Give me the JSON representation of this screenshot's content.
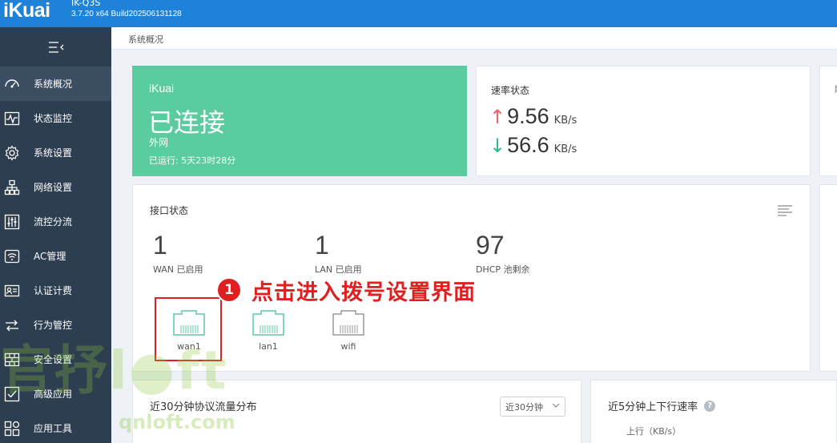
{
  "header": {
    "logo_text": "iKuai",
    "model": "IK-Q3S",
    "build": "3.7.20 x64 Build202506131128"
  },
  "sidebar": {
    "items": [
      {
        "label": "系统概况",
        "icon": "dashboard-icon",
        "active": true
      },
      {
        "label": "状态监控",
        "icon": "monitor-icon",
        "active": false
      },
      {
        "label": "系统设置",
        "icon": "gear-icon",
        "active": false
      },
      {
        "label": "网络设置",
        "icon": "network-icon",
        "active": false
      },
      {
        "label": "流控分流",
        "icon": "sliders-icon",
        "active": false
      },
      {
        "label": "AC管理",
        "icon": "wifi-icon",
        "active": false
      },
      {
        "label": "认证计费",
        "icon": "id-card-icon",
        "active": false
      },
      {
        "label": "行为管控",
        "icon": "arrows-icon",
        "active": false
      },
      {
        "label": "安全设置",
        "icon": "firewall-icon",
        "active": false
      },
      {
        "label": "高级应用",
        "icon": "checklist-icon",
        "active": false
      },
      {
        "label": "应用工具",
        "icon": "apps-icon",
        "active": false
      }
    ]
  },
  "breadcrumb": "系统概况",
  "status_card": {
    "brand": "iKuai",
    "state": "已连接",
    "network": "外网",
    "uptime": "已运行: 5天23时28分"
  },
  "speed_card": {
    "title": "速率状态",
    "up_value": "9.56",
    "up_unit": "KB/s",
    "down_value": "56.6",
    "down_unit": "KB/s"
  },
  "interface_card": {
    "title": "接口状态",
    "stats": [
      {
        "num": "1",
        "label": "WAN 已启用"
      },
      {
        "num": "1",
        "label": "LAN 已启用"
      },
      {
        "num": "97",
        "label": "DHCP 池剩余"
      }
    ],
    "ports": [
      {
        "label": "wan1",
        "color": "#5bcba0"
      },
      {
        "label": "lan1",
        "color": "#5bcba0"
      },
      {
        "label": "wifi",
        "color": "#999999"
      }
    ]
  },
  "annotation": {
    "step": "1",
    "text": "点击进入拨号设置界面"
  },
  "flow_card": {
    "title": "近30分钟协议流量分布",
    "select_value": "近30分钟"
  },
  "rate_card": {
    "title": "近5分钟上下行速率",
    "help": "?",
    "upload_label": "上行（KB/s）"
  },
  "peek": {
    "mark": "网"
  },
  "watermark": {
    "logo": "官抒l●ft",
    "url": "qnloft.com"
  },
  "colors": {
    "topbar": "#1e83d8",
    "sidebar": "#2d3e50",
    "accent_green": "#5bcba0",
    "annotation_red": "#e02020"
  }
}
